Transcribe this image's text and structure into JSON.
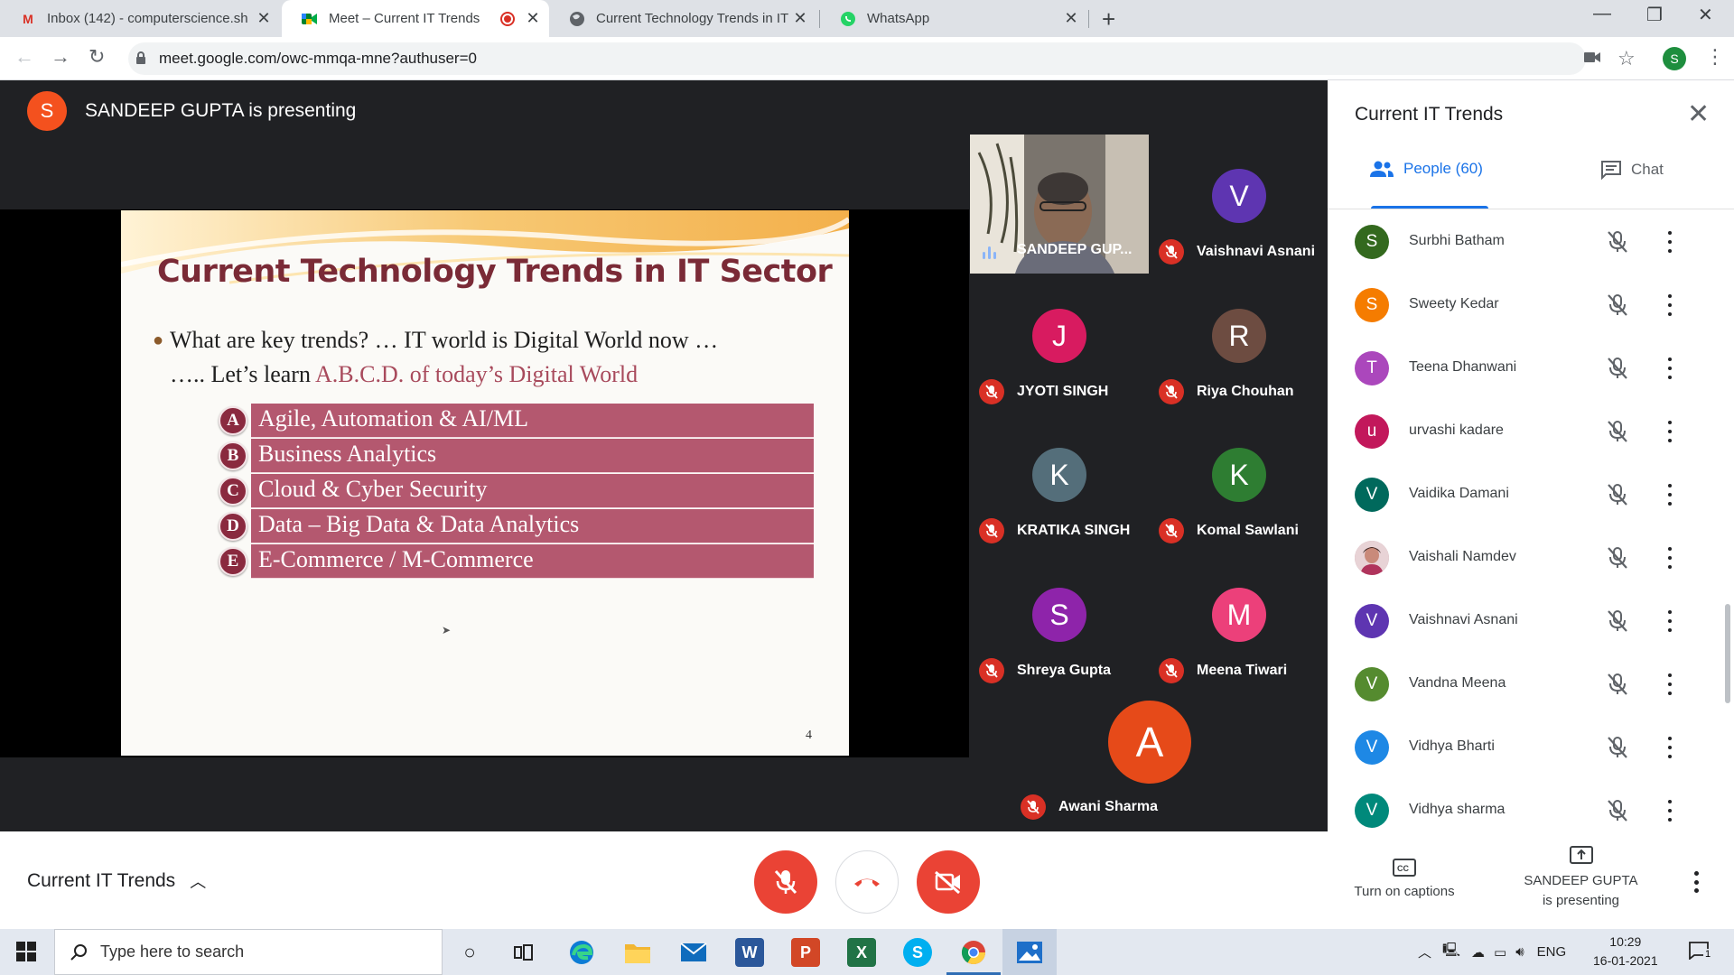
{
  "browser": {
    "tabs": [
      {
        "title": "Inbox (142) - computerscience.sh",
        "icon": "gmail-icon"
      },
      {
        "title": "Meet – Current IT Trends",
        "icon": "meet-icon",
        "recording": true,
        "active": true
      },
      {
        "title": "Current Technology Trends in IT S",
        "icon": "globe-icon"
      },
      {
        "title": "WhatsApp",
        "icon": "whatsapp-icon"
      }
    ],
    "url": "meet.google.com/owc-mmqa-mne?authuser=0",
    "profile_initial": "S"
  },
  "presenter_banner": {
    "initial": "S",
    "text": "SANDEEP GUPTA is presenting"
  },
  "slide": {
    "title": "Current Technology Trends in IT Sector",
    "bullet_line1": "What are key trends? … IT world is Digital World now …",
    "bullet_line2_prefix": "….. Let’s learn ",
    "bullet_line2_highlight": "A.B.C.D. of today’s Digital World",
    "items": [
      {
        "letter": "A",
        "text": "Agile, Automation & AI/ML"
      },
      {
        "letter": "B",
        "text": "Business Analytics"
      },
      {
        "letter": "C",
        "text": "Cloud & Cyber Security"
      },
      {
        "letter": "D",
        "text": "Data – Big Data & Data Analytics"
      },
      {
        "letter": "E",
        "text": "E-Commerce / M-Commerce"
      }
    ],
    "page_number": "4"
  },
  "tiles": {
    "video_tile": {
      "name": "SANDEEP GUP..."
    },
    "participants": [
      {
        "initial": "V",
        "name": "Vaishnavi Asnani",
        "color": "#5e35b1"
      },
      {
        "initial": "J",
        "name": "JYOTI SINGH",
        "color": "#d81b60"
      },
      {
        "initial": "R",
        "name": "Riya Chouhan",
        "color": "#6d4c41"
      },
      {
        "initial": "K",
        "name": "KRATIKA SINGH",
        "color": "#546e7a"
      },
      {
        "initial": "K",
        "name": "Komal Sawlani",
        "color": "#2e7d32"
      },
      {
        "initial": "S",
        "name": "Shreya Gupta",
        "color": "#8e24aa"
      },
      {
        "initial": "M",
        "name": "Meena Tiwari",
        "color": "#ec407a"
      }
    ],
    "big_tile": {
      "initial": "A",
      "name": "Awani Sharma",
      "color": "#e64a19"
    }
  },
  "panel": {
    "title": "Current IT Trends",
    "people_tab": "People (60)",
    "chat_tab": "Chat",
    "people": [
      {
        "initial": "S",
        "name": "Surbhi Batham",
        "color": "#33691e"
      },
      {
        "initial": "S",
        "name": "Sweety Kedar",
        "color": "#f57c00"
      },
      {
        "initial": "T",
        "name": "Teena Dhanwani",
        "color": "#ab47bc"
      },
      {
        "initial": "u",
        "name": "urvashi kadare",
        "color": "#c2185b"
      },
      {
        "initial": "V",
        "name": "Vaidika Damani",
        "color": "#00695c"
      },
      {
        "initial": "",
        "name": "Vaishali Namdev",
        "color": "#c9a0a8",
        "photo": true
      },
      {
        "initial": "V",
        "name": "Vaishnavi Asnani",
        "color": "#5e35b1"
      },
      {
        "initial": "V",
        "name": "Vandna Meena",
        "color": "#558b2f"
      },
      {
        "initial": "V",
        "name": "Vidhya Bharti",
        "color": "#1e88e5"
      },
      {
        "initial": "V",
        "name": "Vidhya sharma",
        "color": "#00897b"
      }
    ]
  },
  "bottombar": {
    "meeting_name": "Current IT Trends",
    "captions_label": "Turn on captions",
    "presenting_line1": "SANDEEP GUPTA",
    "presenting_line2": "is presenting"
  },
  "taskbar": {
    "search_placeholder": "Type here to search",
    "language": "ENG",
    "time": "10:29",
    "date": "16-01-2021",
    "notification_count": "1"
  }
}
